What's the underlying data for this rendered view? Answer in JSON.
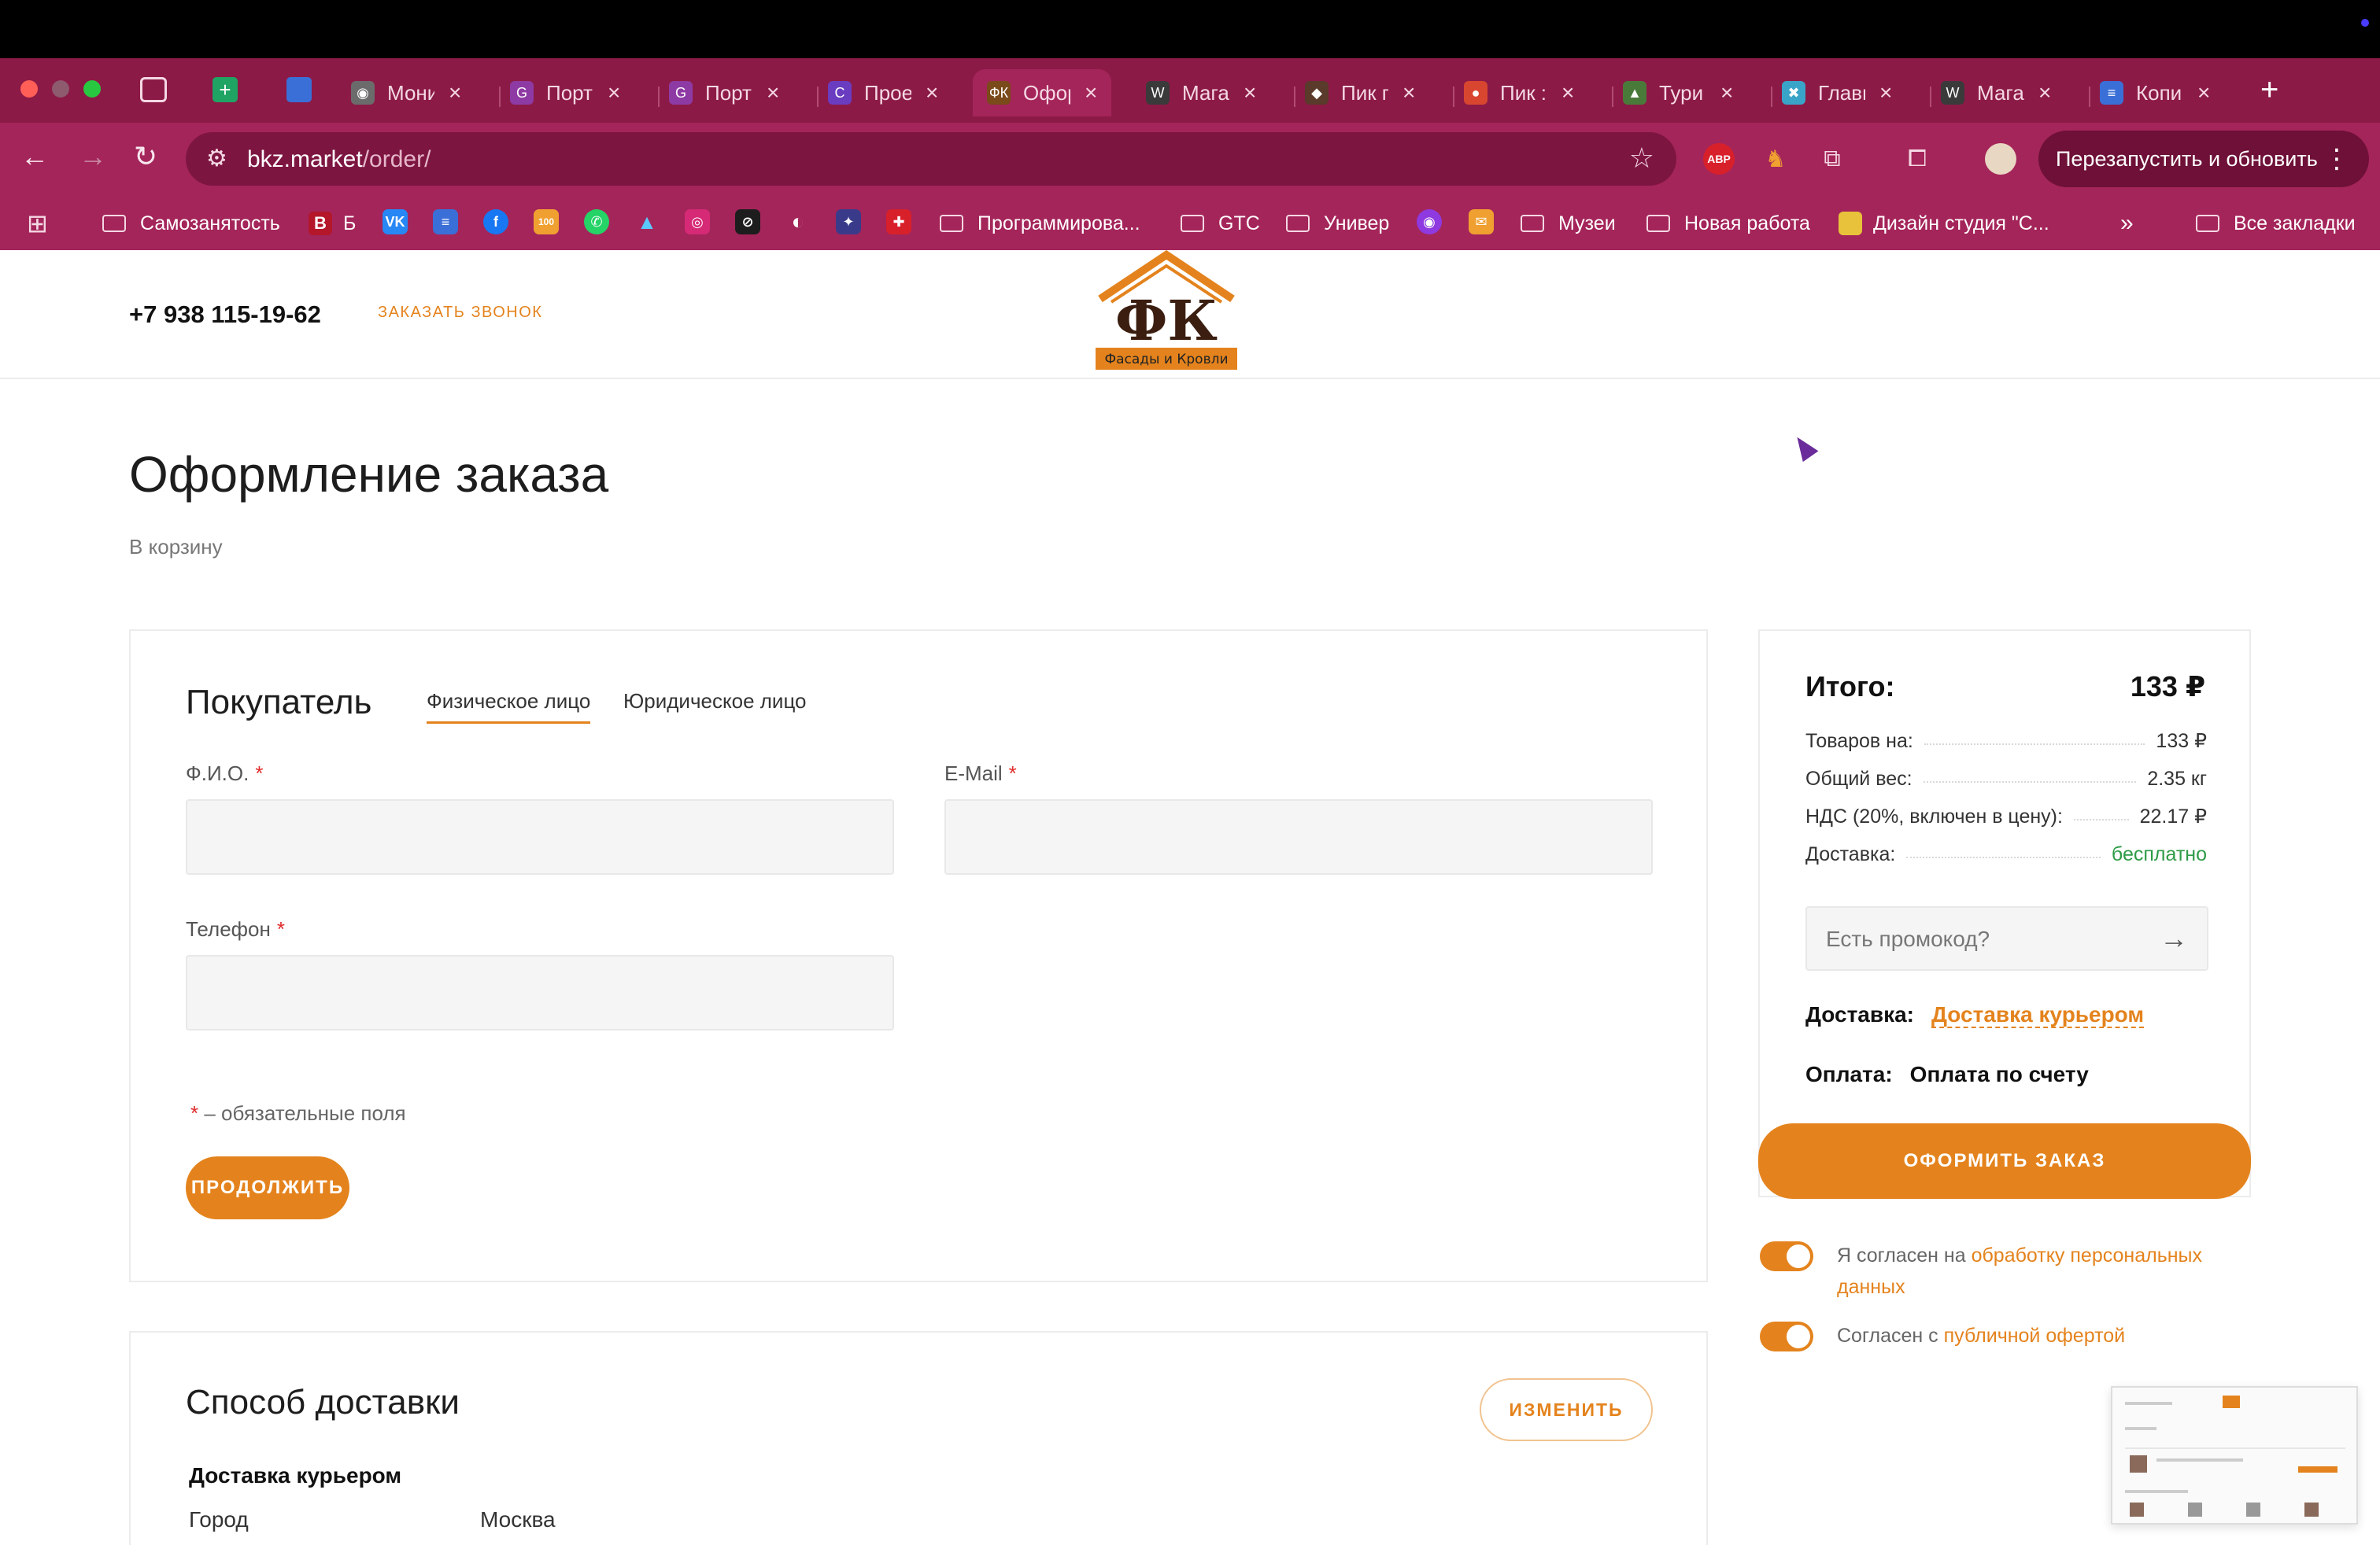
{
  "browser": {
    "tabs": [
      {
        "label": "Мони",
        "fav_bg": "#6b6b6b",
        "fav": "◉",
        "icon": "globe-icon"
      },
      {
        "label": "Порт",
        "fav_bg": "#8e3aa4",
        "fav": "G",
        "icon": "portfolio-icon"
      },
      {
        "label": "Порт",
        "fav_bg": "#8e3aa4",
        "fav": "G",
        "icon": "portfolio-icon"
      },
      {
        "label": "Прое",
        "fav_bg": "#6a3cc0",
        "fav": "C",
        "icon": "project-icon"
      },
      {
        "label": "Офор",
        "fav_bg": "#7a4a1a",
        "fav": "ФК",
        "icon": "site-logo-icon",
        "active": true
      },
      {
        "label": "Мага",
        "fav_bg": "#3a3a3a",
        "fav": "W",
        "icon": "wordpress-icon"
      },
      {
        "label": "Пик г",
        "fav_bg": "#5a3a2a",
        "fav": "◆",
        "icon": "pik-icon"
      },
      {
        "label": "Пик :",
        "fav_bg": "#d9462f",
        "fav": "●",
        "icon": "pik-icon"
      },
      {
        "label": "Тури",
        "fav_bg": "#4a7a3a",
        "fav": "▲",
        "icon": "chart-icon"
      },
      {
        "label": "Главн",
        "fav_bg": "#3aa4c8",
        "fav": "✖",
        "icon": "figma-icon"
      },
      {
        "label": "Мага",
        "fav_bg": "#3a3a3a",
        "fav": "W",
        "icon": "wordpress-icon"
      },
      {
        "label": "Копи",
        "fav_bg": "#3a6fd8",
        "fav": "≡",
        "icon": "docs-icon"
      }
    ],
    "url_host": "bkz.market",
    "url_path": "/order/",
    "relaunch_label": "Перезапустить и обновить",
    "bookmarks": {
      "samozanyatost": "Самозанятость",
      "b": "Б",
      "programming": "Программирова...",
      "gtc": "GTC",
      "univer": "Универ",
      "muzei": "Музеи",
      "new_job": "Новая работа",
      "design_studio": "Дизайн студия \"С...",
      "all_bookmarks": "Все закладки"
    }
  },
  "site": {
    "phone": "+7 938 115-19-62",
    "callback": "ЗАКАЗАТЬ ЗВОНОК",
    "logo_letters": "ФК",
    "logo_caption": "Фасады и Кровли"
  },
  "page": {
    "title": "Оформление заказа",
    "back_link": "В корзину"
  },
  "buyer": {
    "title": "Покупатель",
    "tab_individual": "Физическое лицо",
    "tab_legal": "Юридическое лицо",
    "fio_label": "Ф.И.О.",
    "email_label": "E-Mail",
    "phone_label": "Телефон",
    "required_mark": "*",
    "required_note": "– обязательные поля",
    "continue": "ПРОДОЛЖИТЬ"
  },
  "summary": {
    "title": "Итого:",
    "total": "133 ₽",
    "rows": [
      {
        "label": "Товаров на:",
        "value": "133 ₽"
      },
      {
        "label": "Общий вес:",
        "value": "2.35 кг"
      },
      {
        "label": "НДС (20%, включен в цену):",
        "value": "22.17 ₽"
      },
      {
        "label": "Доставка:",
        "value": "бесплатно"
      }
    ],
    "promo_placeholder": "Есть промокод?",
    "delivery_key": "Доставка:",
    "delivery_value": "Доставка курьером",
    "payment_key": "Оплата:",
    "payment_value": "Оплата по счету",
    "submit": "ОФОРМИТЬ ЗАКАЗ"
  },
  "consents": {
    "c1_prefix": "Я согласен на ",
    "c1_link": "обработку персональных данных",
    "c2_prefix": "Согласен с ",
    "c2_link": "публичной офертой"
  },
  "delivery_block": {
    "title": "Способ доставки",
    "change": "ИЗМЕНИТЬ",
    "method": "Доставка курьером",
    "city_key": "Город",
    "city_value": "Москва"
  },
  "colors": {
    "accent": "#e4831d",
    "chrome": "#a4255a",
    "free": "#2e9b47"
  }
}
